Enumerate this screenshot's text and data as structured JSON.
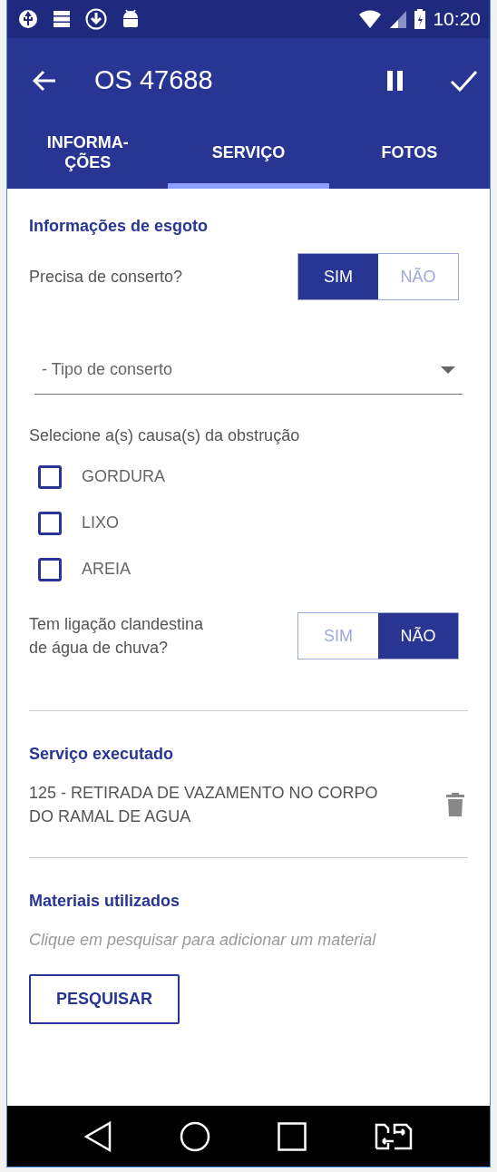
{
  "status_bar": {
    "time": "10:20"
  },
  "app_bar": {
    "title": "OS 47688"
  },
  "tabs": [
    {
      "label": "INFORMA-\nÇÕES",
      "selected": false
    },
    {
      "label": "SERVIÇO",
      "selected": true
    },
    {
      "label": "FOTOS",
      "selected": false
    }
  ],
  "sewer_info": {
    "heading": "Informações de esgoto",
    "repair_question": {
      "label": "Precisa de conserto?",
      "options": [
        {
          "label": "SIM",
          "selected": true
        },
        {
          "label": "NÃO",
          "selected": false
        }
      ]
    },
    "repair_type": {
      "placeholder": "- Tipo de conserto"
    },
    "causes_label": "Selecione a(s) causa(s) da obstrução",
    "causes": [
      {
        "label": "GORDURA",
        "checked": false
      },
      {
        "label": "LIXO",
        "checked": false
      },
      {
        "label": "AREIA",
        "checked": false
      }
    ],
    "rain_question": {
      "label": "Tem ligação clandestina\nde água de chuva?",
      "options": [
        {
          "label": "SIM",
          "selected": false
        },
        {
          "label": "NÃO",
          "selected": true
        }
      ]
    }
  },
  "service": {
    "heading": "Serviço executado",
    "items": [
      "125 - RETIRADA DE VAZAMENTO NO CORPO\nDO RAMAL DE AGUA"
    ]
  },
  "materials": {
    "heading": "Materiais utilizados",
    "hint": "Clique em pesquisar para adicionar um material",
    "button": "PESQUISAR"
  }
}
